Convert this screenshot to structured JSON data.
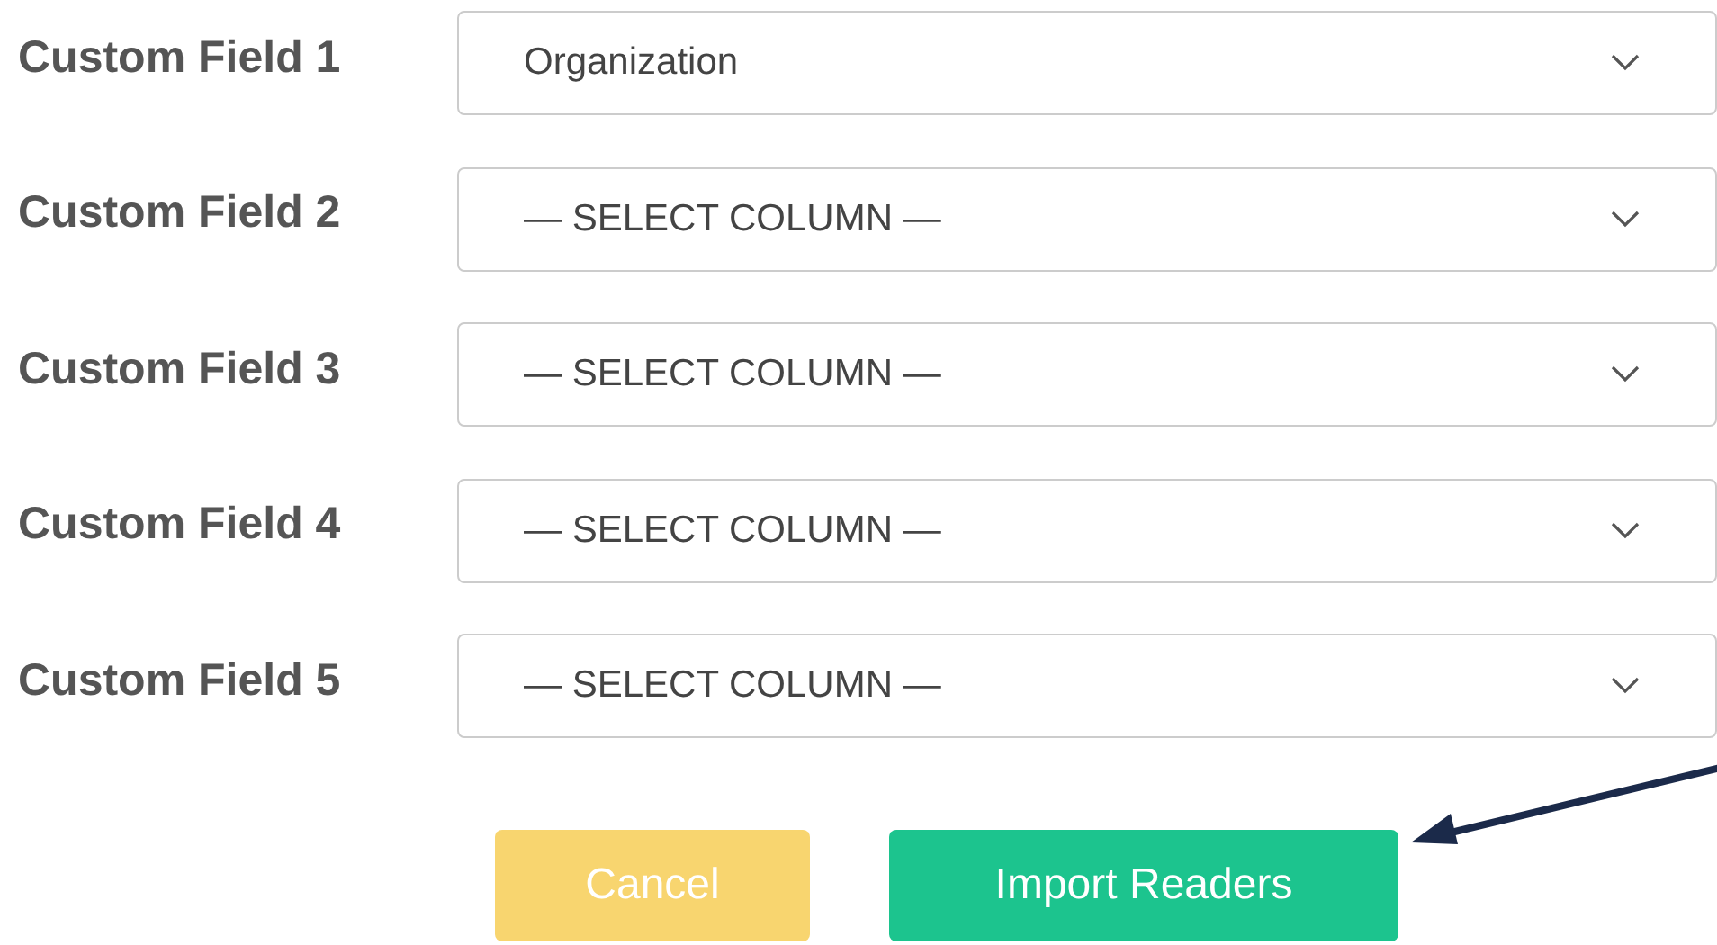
{
  "fields": [
    {
      "label": "Custom Field 1",
      "value": "Organization"
    },
    {
      "label": "Custom Field 2",
      "value": "— SELECT COLUMN —"
    },
    {
      "label": "Custom Field 3",
      "value": "— SELECT COLUMN —"
    },
    {
      "label": "Custom Field 4",
      "value": "— SELECT COLUMN —"
    },
    {
      "label": "Custom Field 5",
      "value": "— SELECT COLUMN —"
    }
  ],
  "buttons": [
    {
      "label": "Cancel",
      "kind": "cancel"
    },
    {
      "label": "Import Readers",
      "kind": "primary"
    }
  ]
}
